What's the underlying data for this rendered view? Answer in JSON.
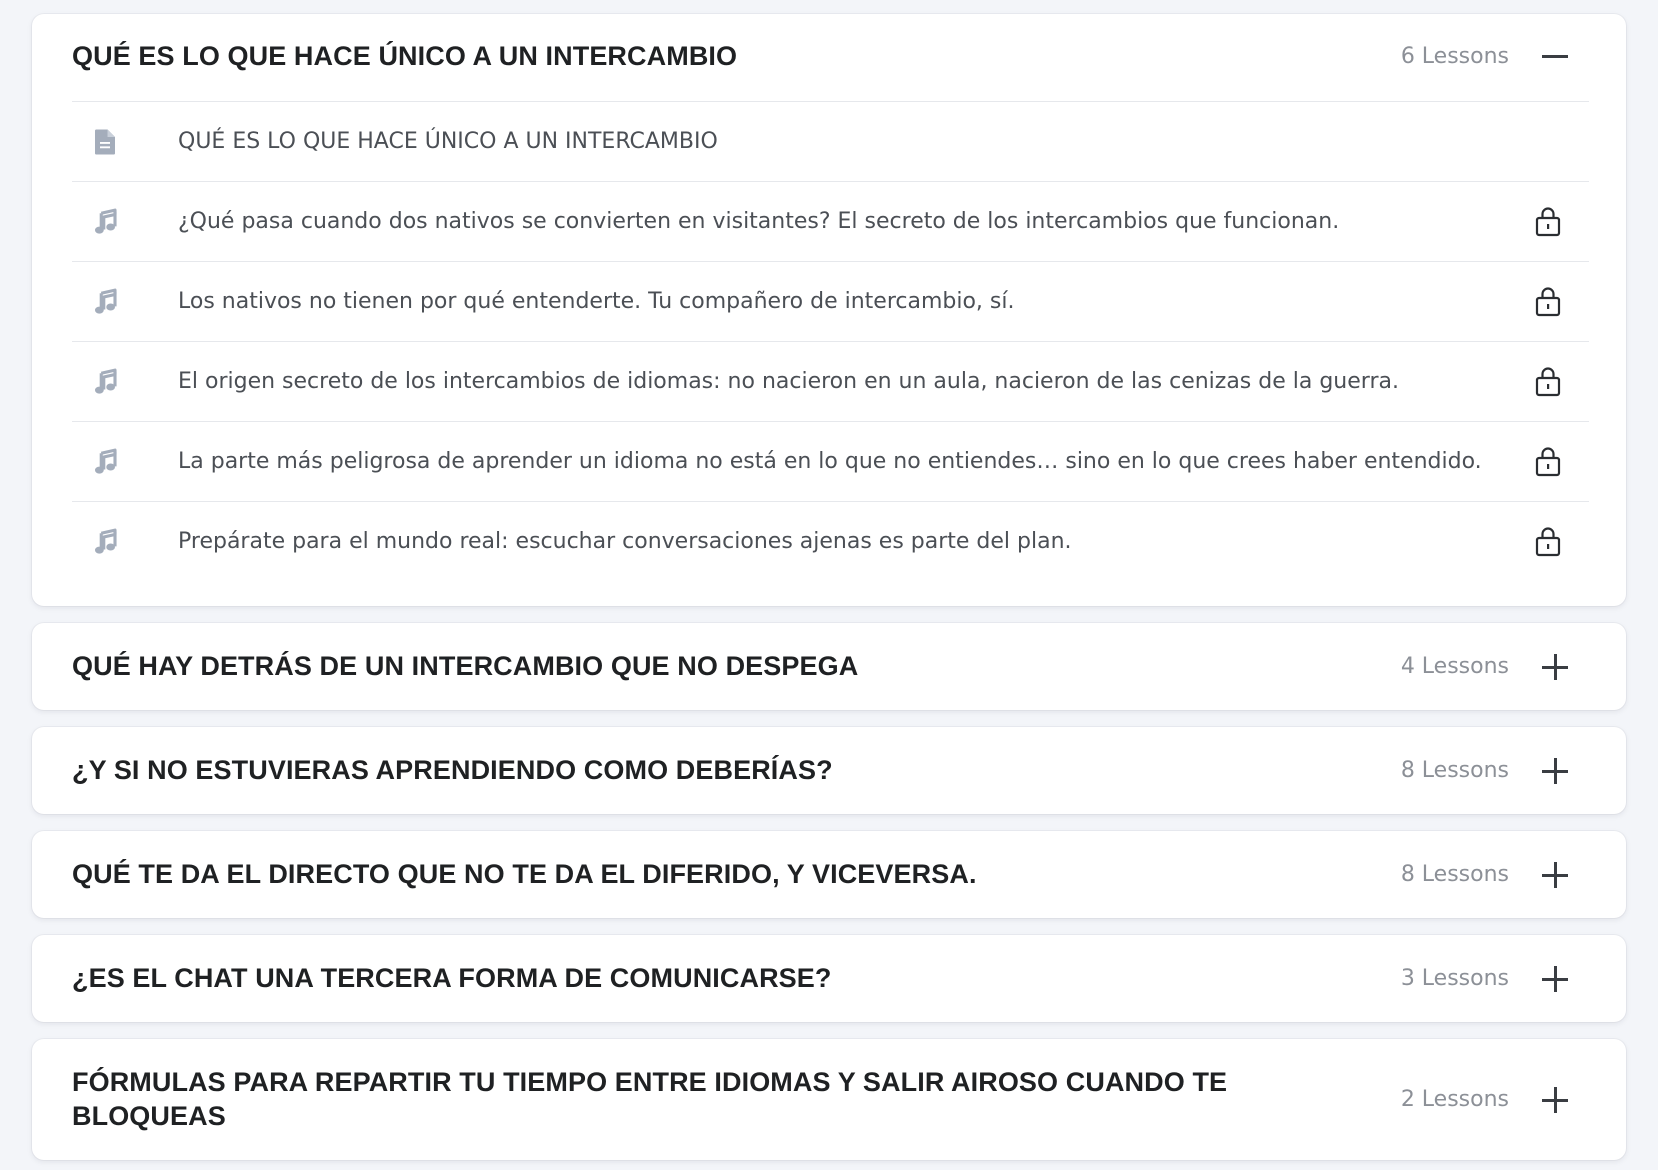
{
  "sections": [
    {
      "title": "QUÉ ES LO QUE HACE ÚNICO A UN INTERCAMBIO",
      "lessons_count": "6 Lessons",
      "expanded": true,
      "toggle_icon": "minus-icon",
      "lessons": [
        {
          "title": "QUÉ ES LO QUE HACE ÚNICO A UN INTERCAMBIO",
          "icon": "document-icon",
          "locked": false
        },
        {
          "title": "¿Qué pasa cuando dos nativos se convierten en visitantes? El secreto de los intercambios que funcionan.",
          "icon": "music-note-icon",
          "locked": true
        },
        {
          "title": "Los nativos no tienen por qué entenderte. Tu compañero de intercambio, sí.",
          "icon": "music-note-icon",
          "locked": true
        },
        {
          "title": "El origen secreto de los intercambios de idiomas: no nacieron en un aula, nacieron de las cenizas de la guerra.",
          "icon": "music-note-icon",
          "locked": true
        },
        {
          "title": "La parte más peligrosa de aprender un idioma no está en lo que no entiendes… sino en lo que crees haber entendido.",
          "icon": "music-note-icon",
          "locked": true
        },
        {
          "title": "Prepárate para el mundo real: escuchar conversaciones ajenas es parte del plan.",
          "icon": "music-note-icon",
          "locked": true
        }
      ]
    },
    {
      "title": "QUÉ HAY DETRÁS DE UN INTERCAMBIO QUE NO DESPEGA",
      "lessons_count": "4 Lessons",
      "expanded": false,
      "toggle_icon": "plus-icon"
    },
    {
      "title": "¿Y SI NO ESTUVIERAS APRENDIENDO COMO DEBERÍAS?",
      "lessons_count": "8 Lessons",
      "expanded": false,
      "toggle_icon": "plus-icon"
    },
    {
      "title": "QUÉ TE DA EL DIRECTO QUE NO TE DA EL DIFERIDO, Y VICEVERSA.",
      "lessons_count": "8 Lessons",
      "expanded": false,
      "toggle_icon": "plus-icon"
    },
    {
      "title": "¿ES EL CHAT UNA TERCERA FORMA DE COMUNICARSE?",
      "lessons_count": "3 Lessons",
      "expanded": false,
      "toggle_icon": "plus-icon"
    },
    {
      "title_line1": "FÓRMULAS PARA REPARTIR TU TIEMPO ENTRE IDIOMAS Y SALIR AIROSO CUANDO TE",
      "title_line2": "BLOQUEAS",
      "lessons_count": "2 Lessons",
      "expanded": false,
      "toggle_icon": "plus-icon"
    }
  ],
  "colors": {
    "background": "#f3f5f9",
    "card": "#ffffff",
    "title": "#1f2123",
    "lesson_text": "#4b4f55",
    "muted": "#8c9097",
    "icon": "#a4adbb"
  }
}
